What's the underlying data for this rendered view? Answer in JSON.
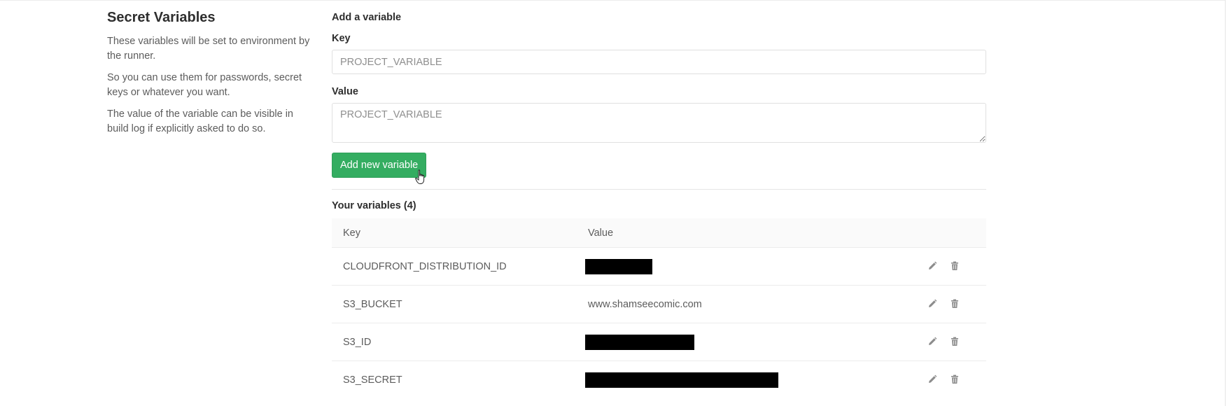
{
  "sidebar": {
    "title": "Secret Variables",
    "paragraphs": [
      "These variables will be set to environment by the runner.",
      "So you can use them for passwords, secret keys or whatever you want.",
      "The value of the variable can be visible in build log if explicitly asked to do so."
    ]
  },
  "form": {
    "title": "Add a variable",
    "key_label": "Key",
    "key_placeholder": "PROJECT_VARIABLE",
    "value_label": "Value",
    "value_placeholder": "PROJECT_VARIABLE",
    "submit_label": "Add new variable"
  },
  "variables": {
    "title": "Your variables (4)",
    "columns": [
      "Key",
      "Value"
    ],
    "rows": [
      {
        "key": "CLOUDFRONT_DISTRIBUTION_ID",
        "value": "",
        "redacted": true
      },
      {
        "key": "S3_BUCKET",
        "value": "www.shamseecomic.com",
        "redacted": false
      },
      {
        "key": "S3_ID",
        "value": "",
        "redacted": true
      },
      {
        "key": "S3_SECRET",
        "value": "",
        "redacted": true
      }
    ],
    "row_actions": [
      "pencil-icon",
      "trash-icon"
    ]
  },
  "colors": {
    "primary_button": "#34ad61",
    "redaction": "#000000"
  }
}
